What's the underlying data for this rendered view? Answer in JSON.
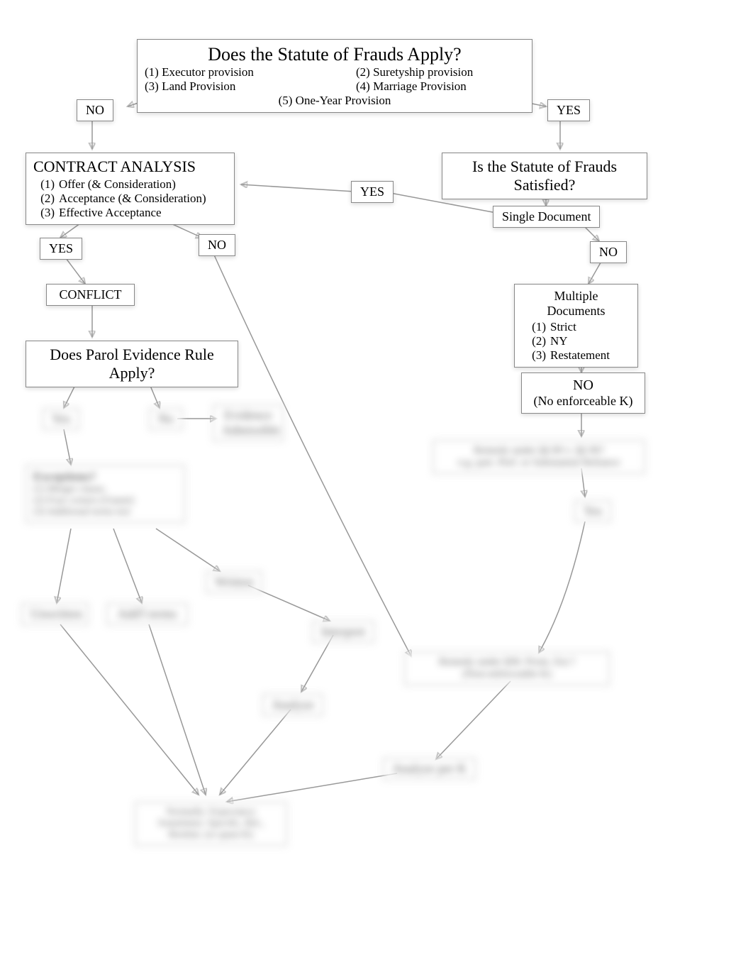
{
  "statute_box": {
    "title": "Does the Statute of Frauds Apply?",
    "prov1": "(1)  Executor provision",
    "prov2": "(2) Suretyship provision",
    "prov3": "(3)  Land Provision",
    "prov4": "(4) Marriage Provision",
    "prov5": "(5)  One-Year Provision"
  },
  "labels": {
    "no": "NO",
    "yes": "YES"
  },
  "contract_analysis": {
    "title": "CONTRACT ANALYSIS",
    "item1_num": "(1)",
    "item1": "Offer (& Consideration)",
    "item2_num": "(2)",
    "item2": "Acceptance (& Consideration)",
    "item3_num": "(3)",
    "item3": "Effective Acceptance"
  },
  "satisfied": {
    "title": "Is the Statute of Frauds Satisfied?"
  },
  "single_doc": "Single Document",
  "multi_docs": {
    "title": "Multiple Documents",
    "item1_num": "(1)",
    "item1": "Strict",
    "item2_num": "(2)",
    "item2": "NY",
    "item3_num": "(3)",
    "item3": "Restatement"
  },
  "conflict": "CONFLICT",
  "parol": "Does Parol Evidence Rule Apply?",
  "no_enforceable": {
    "line1": "NO",
    "line2": "(No enforceable K)"
  },
  "blurred": {
    "n1": "Yes",
    "n2": "No",
    "n3": "Evidence\nAdmissible",
    "exceptions_title": "Exceptions?",
    "exceptions_item1": "(1)  Merger clause,",
    "exceptions_item2": "(2)  Four corners  (Gianni)",
    "exceptions_item3": "(3)  Additional terms test",
    "remedy_8990": "Remedy under §§ 89 v. §§ 90?\ne.g. part. Perf. or Substantial Reliance",
    "yes2": "Yes",
    "written": "Written",
    "unwritten": "Unwritten",
    "add_terms": "Add'l terms",
    "interpret": "Interpret",
    "analyze": "Analyze",
    "analyze_per": "Analyze per K",
    "remedy_90": "Remedy under §90:  Prom. Est.?\n(Non-enforceable K)",
    "normally": "Normally: Expectancy\nSometimes: Specific, Rel.,\nRestitut. (or quasi-K)"
  }
}
